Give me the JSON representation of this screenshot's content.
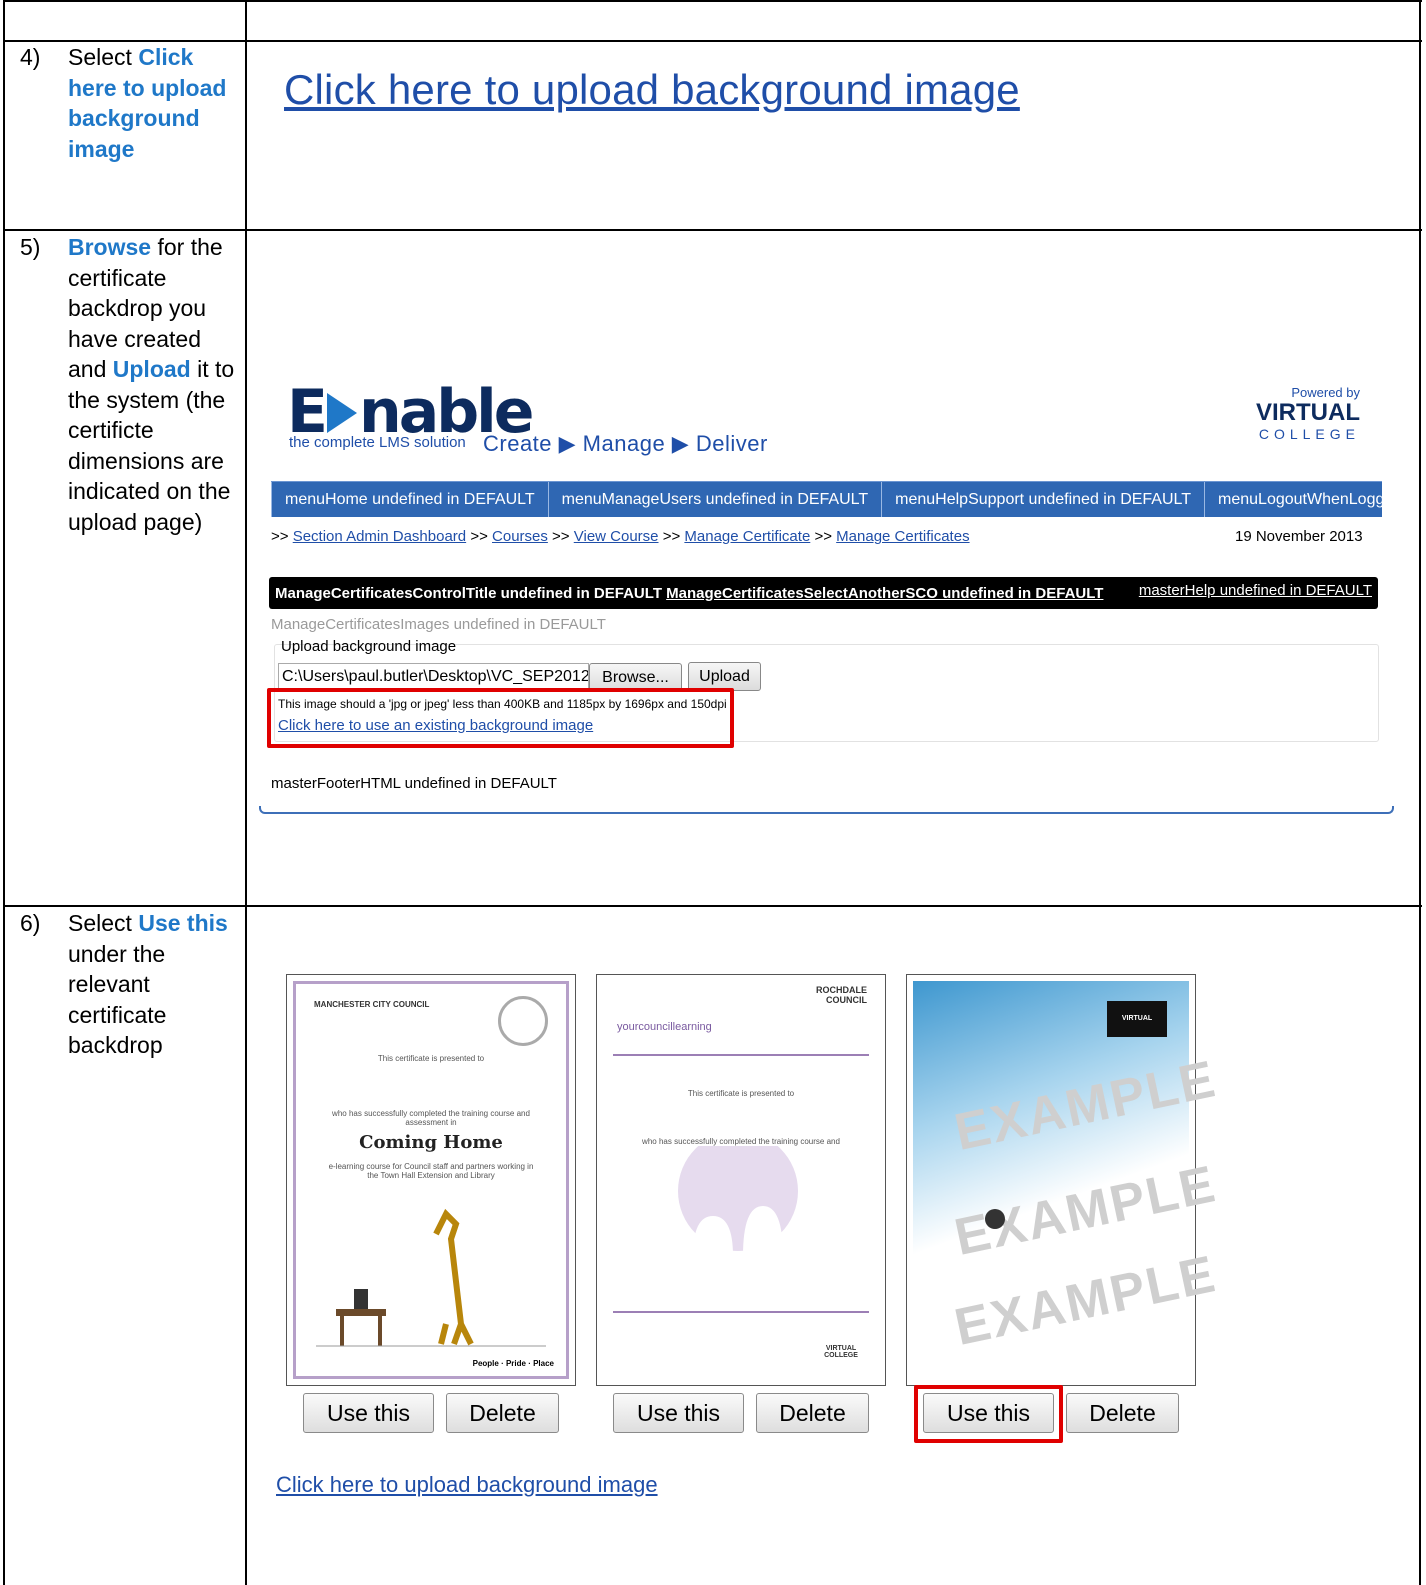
{
  "steps": [
    {
      "num": "4)",
      "pre": "Select ",
      "hl": "Click here to upload background image",
      "post": ""
    },
    {
      "num": "5)",
      "hl1": "Browse",
      "mid1": " for the certificate backdrop you have created and ",
      "hl2": "Upload",
      "mid2": " it to the system (the certificte dimensions are indicated on the upload page)"
    },
    {
      "num": "6)",
      "pre": "Select ",
      "hl": "Use this",
      "post": " under the relevant certificate backdrop"
    }
  ],
  "step4": {
    "link": "Click here to upload background image"
  },
  "enable": {
    "logo_left": "E",
    "logo_right": "nable",
    "subtitle": "the complete LMS solution",
    "tagline": "Create ▶ Manage ▶ Deliver",
    "powered": "Powered by",
    "virtual": "VIRTUAL",
    "college": "COLLEGE",
    "menu": [
      "menuHome undefined in DEFAULT",
      "menuManageUsers undefined in DEFAULT",
      "menuHelpSupport undefined in DEFAULT",
      "menuLogoutWhenLoggedIn"
    ],
    "crumb_sep": ">>",
    "crumbs": [
      "Section Admin Dashboard",
      "Courses",
      "View Course",
      "Manage Certificate",
      "Manage Certificates"
    ],
    "date": "19 November 2013",
    "title_left": "ManageCertificatesControlTitle undefined in DEFAULT",
    "title_link": "ManageCertificatesSelectAnotherSCO undefined in DEFAULT",
    "title_help": "masterHelp undefined in DEFAULT",
    "images_label": "ManageCertificatesImages undefined in DEFAULT",
    "upload_label": "Upload background image",
    "file_value": "C:\\Users\\paul.butler\\Desktop\\VC_SEP2012_",
    "browse": "Browse...",
    "upload": "Upload",
    "hint": "This image should a 'jpg or jpeg' less than 400KB and 1185px by 1696px and 150dpi",
    "existing_link": "Click here to use an existing background image",
    "footer": "masterFooterHTML undefined in DEFAULT"
  },
  "certs": [
    {
      "org": "MANCHESTER CITY COUNCIL",
      "presented": "This certificate is presented to",
      "completed": "who has successfully completed the training course and assessment in",
      "course": "Coming Home",
      "desc": "e-learning course for Council staff and partners working in the Town Hall Extension and Library",
      "motto": "People · Pride · Place",
      "use": "Use this",
      "delete": "Delete"
    },
    {
      "org": "ROCHDALE COUNCIL",
      "brand": "yourcouncillearning",
      "presented": "This certificate is presented to",
      "completed": "who has successfully completed the training course and assessment in",
      "logo": "VIRTUAL COLLEGE",
      "use": "Use this",
      "delete": "Delete"
    },
    {
      "logo": "VIRTUAL COLLEGE",
      "watermark": "EXAMPLE",
      "use": "Use this",
      "delete": "Delete"
    }
  ],
  "step6": {
    "link": "Click here to upload background image"
  },
  "colors": {
    "accent": "#1f78c8",
    "link": "#1f4ea8",
    "highlight": "#e00000",
    "menubar": "#2f67b3"
  }
}
